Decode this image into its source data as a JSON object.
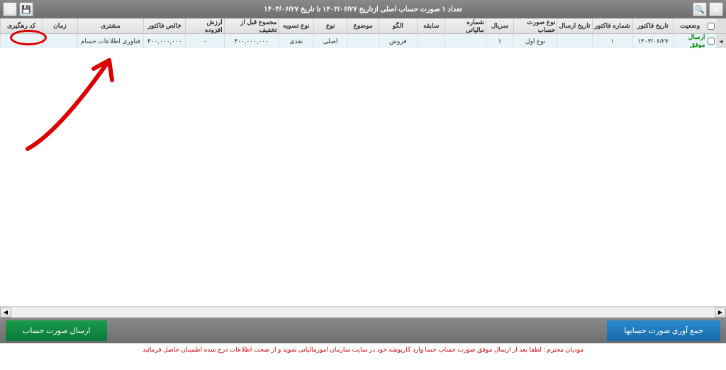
{
  "toolbar": {
    "title": "تعداد ۱ صورت حساب اصلی ازتاریخ ۱۴۰۳/۰۶/۲۷ تا تاریخ ۱۴۰۳/۰۶/۲۷",
    "icons": {
      "save": "💾",
      "print": "🖨",
      "warn": "⚠",
      "search": "🔍"
    }
  },
  "headers": {
    "status": "وضعیت",
    "inv_date": "تاریخ فاکتور",
    "inv_no": "شماره فاکتور",
    "send_date": "تاریخ ارسال",
    "acc_type": "نوع صورت حساب",
    "serial": "سریال",
    "tax_no": "شماره مالیاتی",
    "prev": "سابقه",
    "pattern": "الگو",
    "subject": "موضوع",
    "type": "نوع",
    "settle": "نوع تسویه",
    "pre_disc": "مجموع قبل از تخفیف",
    "vat": "ارزش افزوده",
    "net": "خالص فاکتور",
    "customer": "مشتری",
    "time": "زمان",
    "track": "کد رهگیری"
  },
  "row": {
    "status": "ارسال موفق",
    "inv_date": "۱۴۰۳/۰۶/۲۷",
    "inv_no": "۱",
    "send_date": "",
    "acc_type": "نوع اول",
    "serial": "۱",
    "tax_no": "",
    "prev": "",
    "pattern": "فروش",
    "subject": "",
    "type": "اصلی",
    "settle": "نقدی",
    "pre_disc": "۴۰۰,۰۰۰,۰۰۰",
    "vat": "۰",
    "net": "۴۰۰,۰۰۰,۰۰۰",
    "customer": "فناوری اطلاعات حسام",
    "time": "",
    "track": ""
  },
  "buttons": {
    "send": "ارسال صورت حساب",
    "collect": "جمع آوری صورت حسابها"
  },
  "notice": "مودیان محترم : لطفا بعد از ارسال موفق صورت حساب حتما وارد کارپوشه خود در سایت سازمان امورمالیاتی شوید و از صحت اطلاعات درج شده اطمینان حاصل فرمائید"
}
